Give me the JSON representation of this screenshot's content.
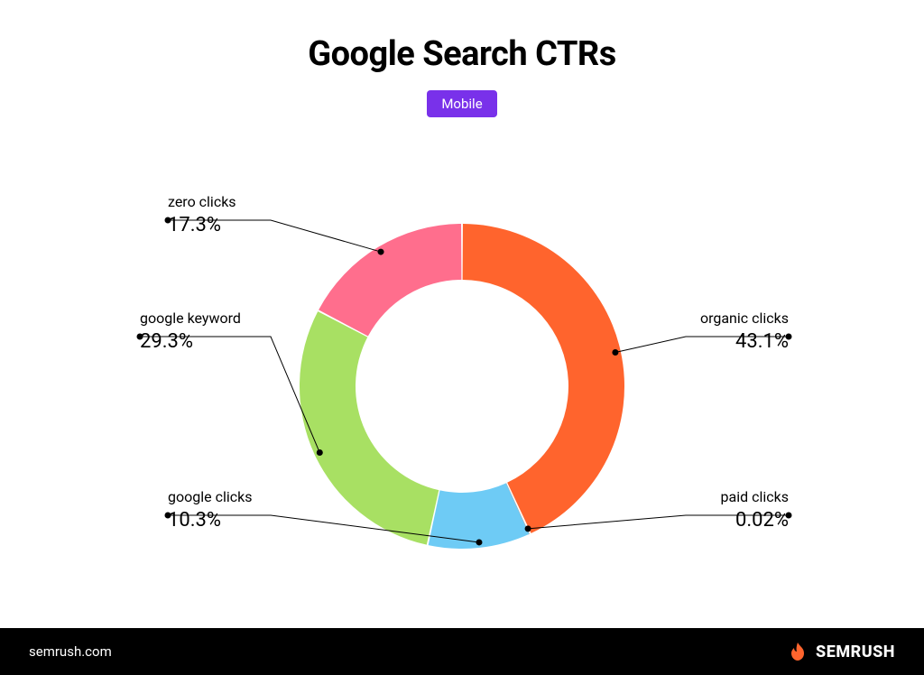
{
  "title": "Google Search CTRs",
  "badge": "Mobile",
  "footer_site": "semrush.com",
  "brand_name": "SEMRUSH",
  "labels": {
    "organic": {
      "name": "organic clicks",
      "value": "43.1%"
    },
    "paid": {
      "name": "paid clicks",
      "value": "0.02%"
    },
    "gclicks": {
      "name": "google clicks",
      "value": "10.3%"
    },
    "gkeyword": {
      "name": "google keyword",
      "value": "29.3%"
    },
    "zero": {
      "name": "zero clicks",
      "value": "17.3%"
    }
  },
  "chart_data": {
    "type": "pie",
    "title": "Google Search CTRs",
    "subtitle": "Mobile",
    "series": [
      {
        "name": "organic clicks",
        "value": 43.1,
        "color": "#FF642D"
      },
      {
        "name": "paid clicks",
        "value": 0.02,
        "color": "#FF642D"
      },
      {
        "name": "google clicks",
        "value": 10.3,
        "color": "#6ECBF5"
      },
      {
        "name": "google keyword",
        "value": 29.3,
        "color": "#A8E063"
      },
      {
        "name": "zero clicks",
        "value": 17.3,
        "color": "#FF6E8D"
      }
    ],
    "donut": true,
    "start_angle_deg": 0
  }
}
